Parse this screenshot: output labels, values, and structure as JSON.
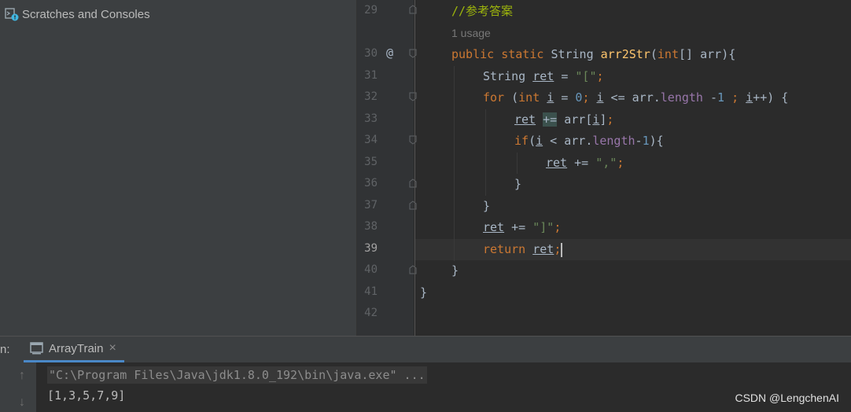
{
  "project_panel": {
    "scratches_label": "Scratches and Consoles"
  },
  "editor": {
    "line_numbers": [
      "29",
      "30",
      "31",
      "32",
      "33",
      "34",
      "35",
      "36",
      "37",
      "38",
      "39",
      "40",
      "41",
      "42"
    ],
    "current_line": "39",
    "override_marker": "@",
    "usage_hint": "1 usage",
    "comment": "//参考答案",
    "tokens": {
      "public": "public",
      "static": "static",
      "String": "String",
      "arr2Str": "arr2Str",
      "int": "int",
      "for": "for",
      "if": "if",
      "return": "return",
      "ret": "ret",
      "i": "i",
      "arr": "arr",
      "length": "length",
      "str_open": "\"[\"",
      "str_comma": "\",\"",
      "str_close": "\"]\"",
      "zero": "0",
      "one": "1"
    }
  },
  "run_panel": {
    "label": "n:",
    "tab_title": "ArrayTrain",
    "tab_close": "×",
    "command": "\"C:\\Program Files\\Java\\jdk1.8.0_192\\bin\\java.exe\" ...",
    "output": "[1,3,5,7,9]",
    "up_glyph": "↑",
    "down_glyph": "↓"
  },
  "watermark": "CSDN @LengchenAI",
  "colors": {
    "keyword": "#cc7832",
    "function": "#ffc66d",
    "string": "#6a8759",
    "number": "#6897bb",
    "field": "#9876aa",
    "comment": "#9db50c"
  }
}
